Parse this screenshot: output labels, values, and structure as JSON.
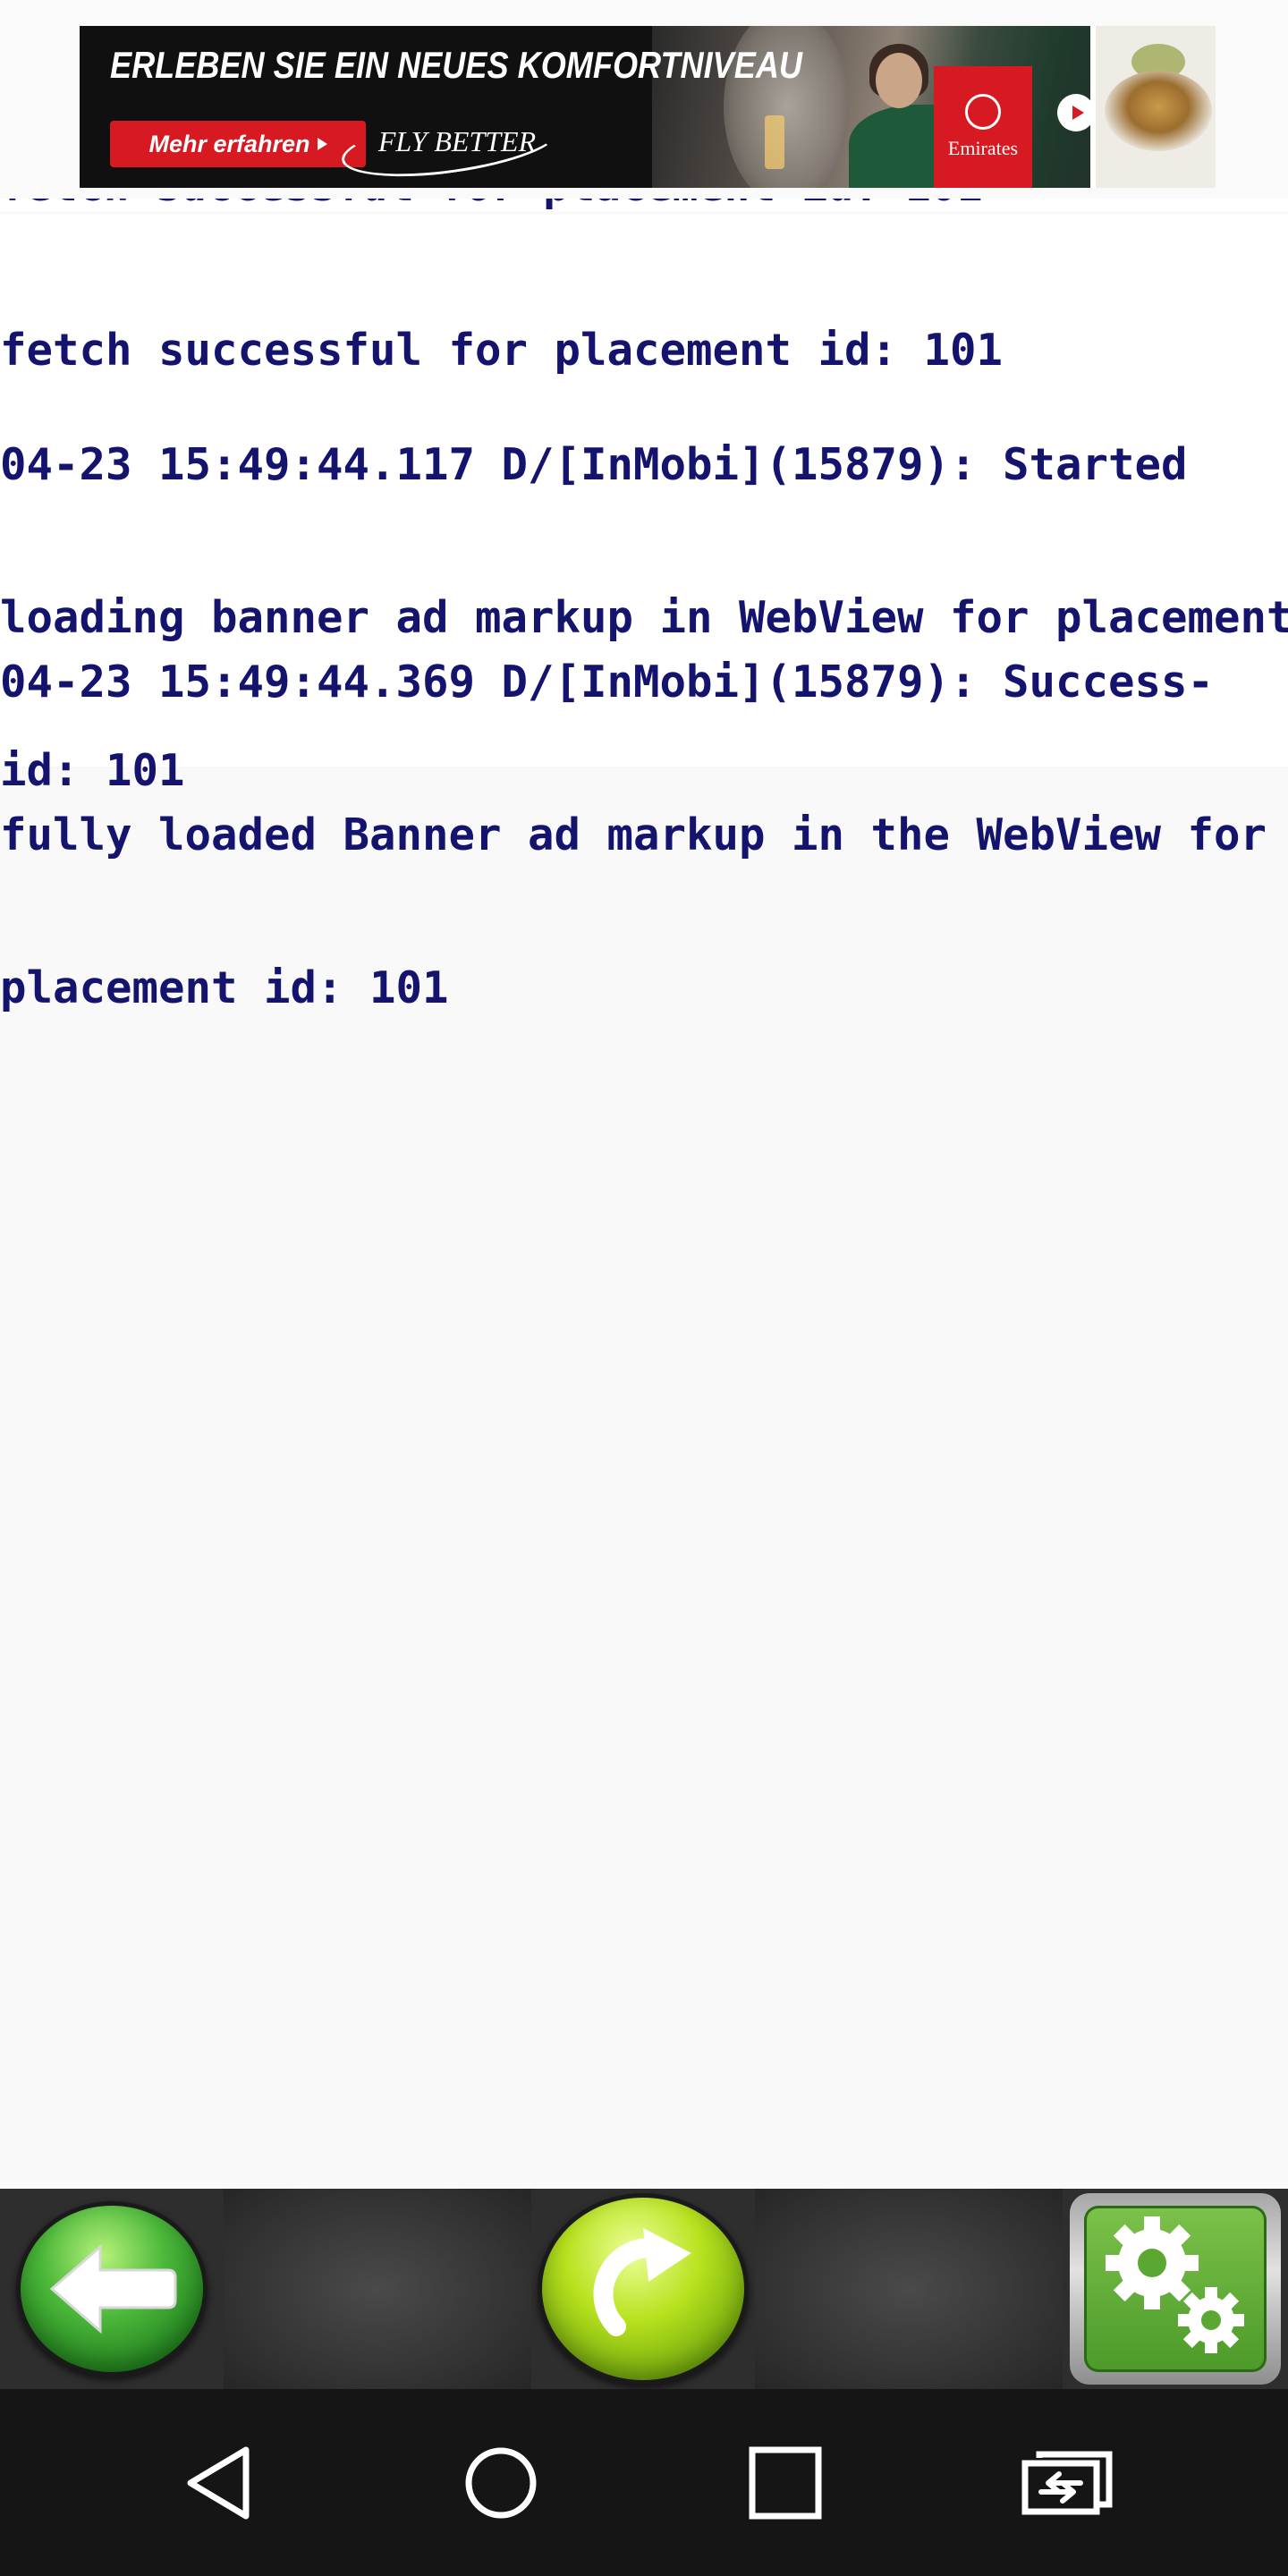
{
  "ad": {
    "headline": "ERLEBEN SIE EIN NEUES KOMFORTNIVEAU",
    "cta_label": "Mehr erfahren",
    "slogan": "FLY BETTER",
    "brand": "Emirates",
    "colors": {
      "brand_red": "#d71921",
      "banner_bg": "#101010"
    }
  },
  "log": {
    "text_color": "#14146e",
    "clipped_line": "fetch successful for placement id: 101",
    "entries": [
      {
        "lines": [
          "fetch successful for placement id: 101"
        ]
      },
      {
        "lines": [
          "04-23 15:49:44.117 D/[InMobi](15879): Started",
          "loading banner ad markup in WebView for placement",
          "id: 101"
        ]
      },
      {
        "lines": [
          "04-23 15:49:44.369 D/[InMobi](15879): Success-",
          "fully loaded Banner ad markup in the WebView for",
          "placement id: 101"
        ]
      }
    ]
  },
  "toolbar": {
    "back_icon": "arrow-left-icon",
    "refresh_icon": "refresh-icon",
    "settings_icon": "gears-icon",
    "colors": {
      "back_green": "#2f9a2a",
      "refresh_lime": "#a6d619",
      "settings_green": "#5aa832"
    }
  },
  "nav_bar": {
    "icons": [
      "back-triangle-icon",
      "home-circle-icon",
      "recents-square-icon",
      "screen-switch-icon"
    ],
    "background": "#151515"
  }
}
